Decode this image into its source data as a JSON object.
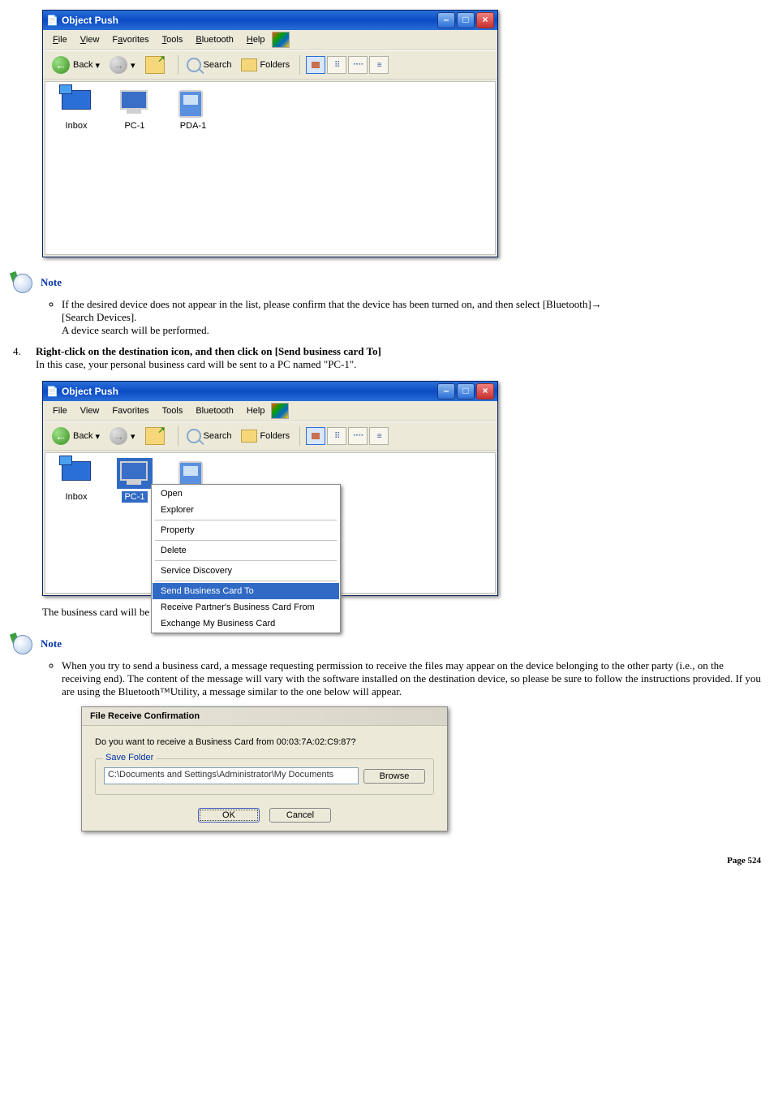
{
  "window1": {
    "title": "Object Push",
    "menus": {
      "file": "File",
      "view": "View",
      "favorites": "Favorites",
      "tools": "Tools",
      "bluetooth": "Bluetooth",
      "help": "Help"
    },
    "toolbar": {
      "back": "Back",
      "search": "Search",
      "folders": "Folders"
    },
    "devices": {
      "inbox": "Inbox",
      "pc1": "PC-1",
      "pda1": "PDA-1"
    }
  },
  "note1": {
    "heading": "Note",
    "item_line1": "If the desired device does not appear in the list, please confirm that the device has been turned on, and then select [Bluetooth]→",
    "item_line2": "[Search Devices].",
    "item_line3": "A device search will be performed."
  },
  "step4": {
    "num": "4.",
    "title": "Right-click on the destination icon, and then click on [Send business card To]",
    "desc": "In this case, your personal business card will be sent to a PC named \"PC-1\"."
  },
  "window2": {
    "title": "Object Push",
    "menus": {
      "file": "File",
      "view": "View",
      "favorites": "Favorites",
      "tools": "Tools",
      "bluetooth": "Bluetooth",
      "help": "Help"
    },
    "toolbar": {
      "back": "Back",
      "search": "Search",
      "folders": "Folders"
    },
    "devices": {
      "inbox": "Inbox",
      "pc1": "PC-1",
      "pda1": "PDA-1"
    },
    "contextmenu": {
      "open": "Open",
      "explorer": "Explorer",
      "property": "Property",
      "delete": "Delete",
      "service_discovery": "Service Discovery",
      "send_business_card": "Send Business Card To",
      "receive_partners": "Receive Partner's Business Card From",
      "exchange": "Exchange My Business Card"
    }
  },
  "sent_text": "The business card will be sent.",
  "note2": {
    "heading": "Note",
    "text": "When you try to send a business card, a message requesting permission to receive the files may appear on the device belonging to the other party (i.e., on the receiving end). The content of the message will vary with the software installed on the destination device, so please be sure to follow the instructions provided. If you are using the Bluetooth™Utility, a message similar to the one below will appear."
  },
  "dialog": {
    "title": "File Receive Confirmation",
    "question": "Do you want to receive a Business Card from 00:03:7A:02:C9:87?",
    "legend": "Save Folder",
    "path": "C:\\Documents and Settings\\Administrator\\My Documents",
    "browse": "Browse",
    "ok": "OK",
    "cancel": "Cancel"
  },
  "page_label": "Page 524"
}
